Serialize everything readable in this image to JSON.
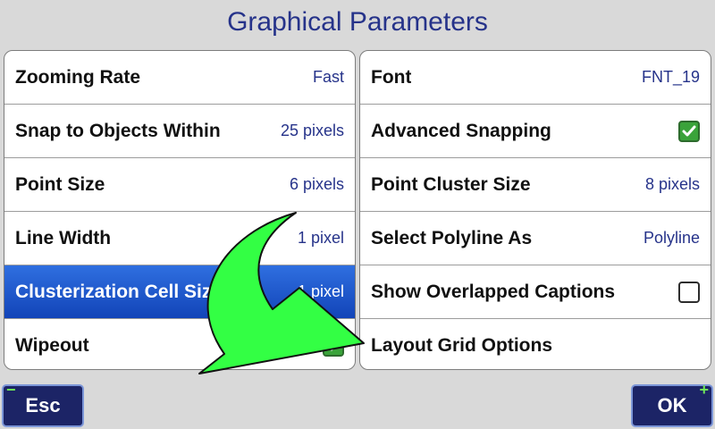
{
  "title": "Graphical Parameters",
  "left_settings": [
    {
      "label": "Zooming Rate",
      "value": "Fast"
    },
    {
      "label": "Snap to Objects Within",
      "value": "25 pixels"
    },
    {
      "label": "Point Size",
      "value": "6 pixels"
    },
    {
      "label": "Line Width",
      "value": "1 pixel"
    },
    {
      "label": "Clusterization Cell Size",
      "value": "1 pixel",
      "selected": true
    },
    {
      "label": "Wipeout",
      "value": "",
      "checked": true
    }
  ],
  "right_settings": [
    {
      "label": "Font",
      "value": "FNT_19"
    },
    {
      "label": "Advanced Snapping",
      "checked": true
    },
    {
      "label": "Point Cluster Size",
      "value": "8 pixels"
    },
    {
      "label": "Select Polyline As",
      "value": "Polyline"
    },
    {
      "label": "Show Overlapped Captions",
      "checked": false
    },
    {
      "label": "Layout Grid Options"
    }
  ],
  "buttons": {
    "esc": "Esc",
    "esc_sign": "−",
    "ok": "OK",
    "ok_sign": "+"
  },
  "colors": {
    "title": "#26338a",
    "selected_row": "#1a55c9",
    "button_bg": "#1c2466",
    "checkbox_checked": "#3aa33a",
    "arrow": "#33ff44"
  },
  "icons": {
    "checkmark": "checkmark-icon",
    "hint_arrow": "curved-arrow-icon"
  }
}
